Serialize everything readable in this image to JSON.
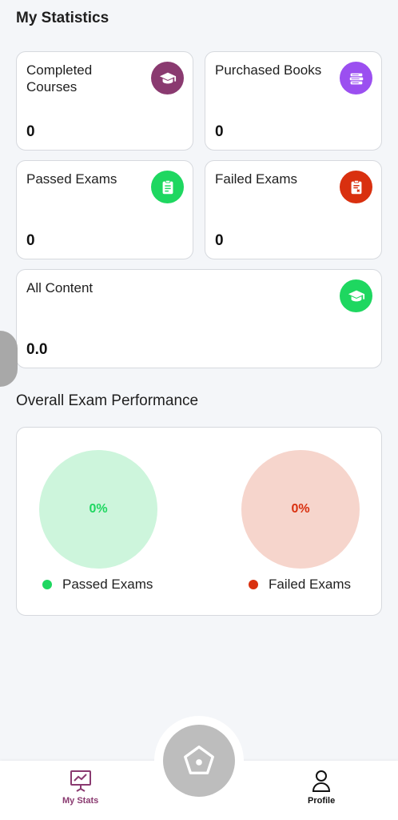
{
  "header": {
    "title": "My Statistics"
  },
  "stats": {
    "completed_courses": {
      "label": "Completed Courses",
      "value": "0",
      "icon": "graduation-cap-icon",
      "color": "#8a3a70"
    },
    "purchased_books": {
      "label": "Purchased Books",
      "value": "0",
      "icon": "books-icon",
      "color": "#9b4ff0"
    },
    "passed_exams": {
      "label": "Passed Exams",
      "value": "0",
      "icon": "clipboard-check-icon",
      "color": "#1ed760"
    },
    "failed_exams": {
      "label": "Failed Exams",
      "value": "0",
      "icon": "clipboard-x-icon",
      "color": "#d9300f"
    },
    "all_content": {
      "label": "All Content",
      "value": "0.0",
      "icon": "graduation-cap-icon",
      "color": "#1ed760"
    }
  },
  "performance": {
    "title": "Overall Exam Performance",
    "passed": {
      "percent": "0%",
      "legend": "Passed Exams",
      "color": "#1ed760",
      "fill": "#cdf5dc"
    },
    "failed": {
      "percent": "0%",
      "legend": "Failed Exams",
      "color": "#d9300f",
      "fill": "#f6d5cc"
    }
  },
  "nav": {
    "my_stats": {
      "label": "My Stats",
      "icon": "chart-board-icon",
      "color": "#8a3a70"
    },
    "home": {
      "icon": "home-pentagon-icon"
    },
    "profile": {
      "label": "Profile",
      "icon": "person-icon"
    }
  }
}
